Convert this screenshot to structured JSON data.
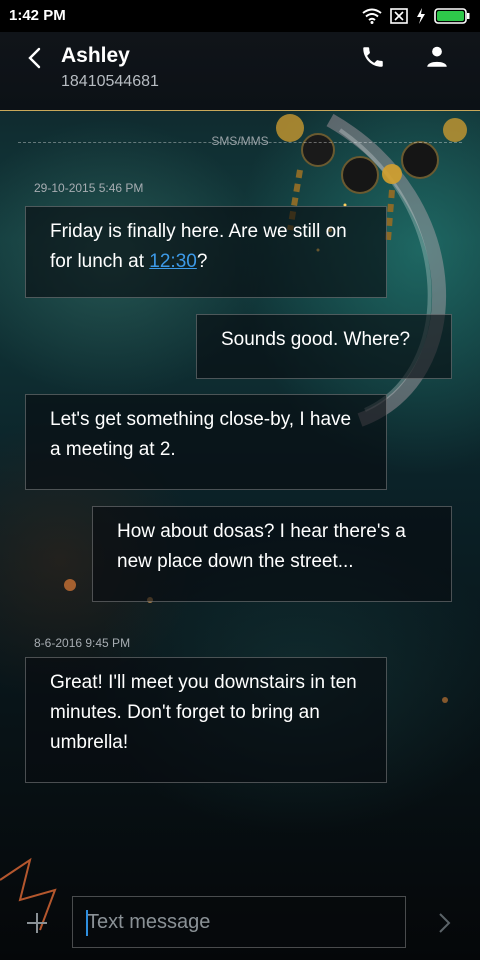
{
  "status_bar": {
    "time": "1:42 PM",
    "icons": [
      "wifi-icon",
      "no-sim-icon",
      "charging-icon",
      "battery-icon"
    ]
  },
  "header": {
    "contact_name": "Ashley",
    "contact_number": "18410544681",
    "icons": [
      "back-icon",
      "phone-icon",
      "person-icon"
    ]
  },
  "thread": {
    "channel_label": "SMS/MMS",
    "timestamps": [
      "29-10-2015 5:46 PM",
      "8-6-2016 9:45 PM"
    ],
    "messages": [
      {
        "direction": "incoming",
        "text_before_link": "Friday is finally here. Are we still on for lunch at ",
        "link": "12:30",
        "text_after_link": "?"
      },
      {
        "direction": "outgoing",
        "text": "Sounds good. Where?"
      },
      {
        "direction": "incoming",
        "text": "Let's get something close-by, I have a meeting at 2."
      },
      {
        "direction": "outgoing",
        "text": "How about dosas? I hear there's a new place down the street..."
      },
      {
        "direction": "incoming",
        "text": "Great! I'll meet you downstairs in ten minutes. Don't forget to bring an umbrella!"
      }
    ]
  },
  "composer": {
    "placeholder": "Text message",
    "icons": [
      "plus-icon",
      "send-chevron-icon"
    ]
  },
  "colors": {
    "accent_link": "#3d9ae8",
    "header_border": "#c9a95a",
    "caret": "#2e8fe0"
  }
}
